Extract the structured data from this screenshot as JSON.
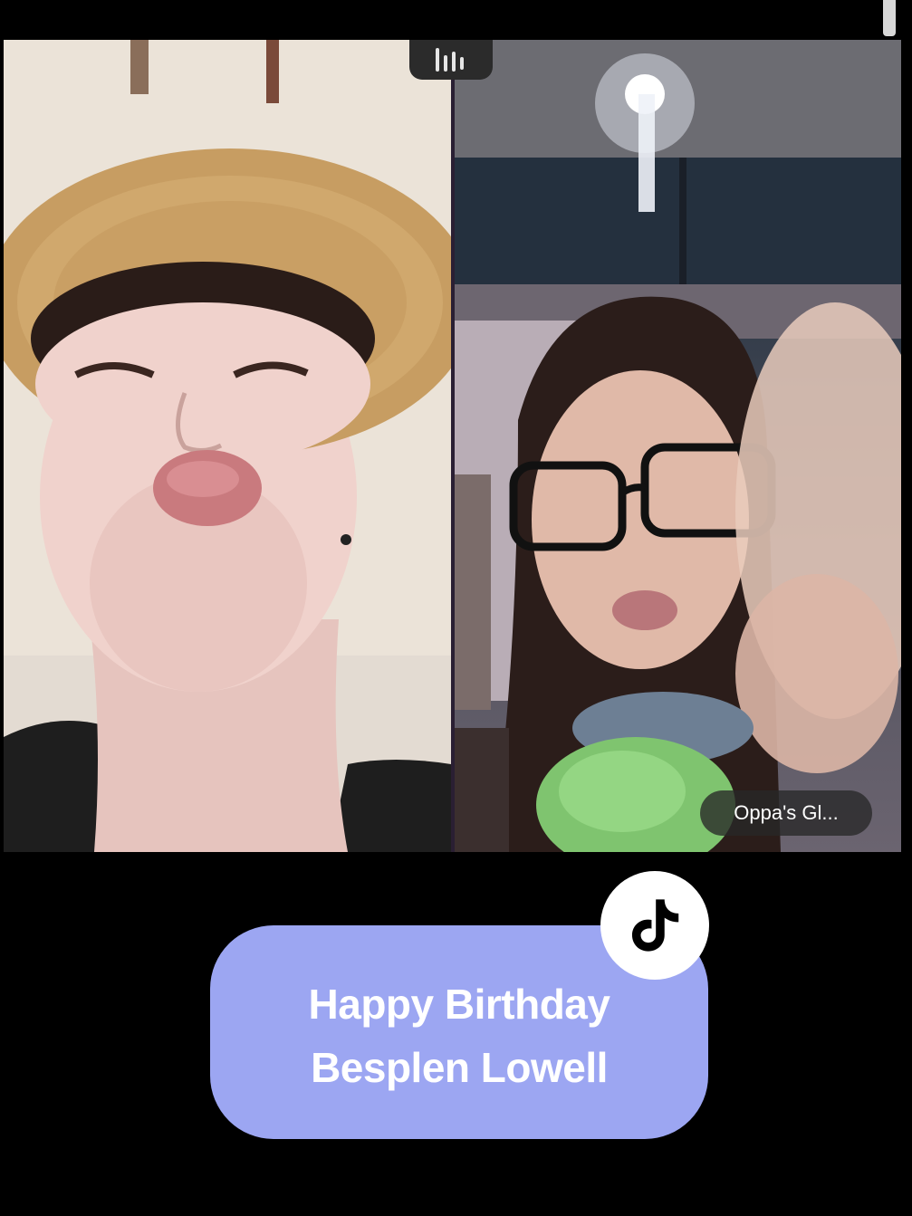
{
  "call": {
    "speaker_indicator_icon": "speaker-bars-icon",
    "left_participant_icon": "person-in-straw-hat",
    "right_participant_icon": "person-with-glasses",
    "right_participant_name": "Oppa's Gl..."
  },
  "caption": {
    "line1": "Happy Birthday",
    "line2": "Besplen Lowell"
  },
  "badge": {
    "icon": "tiktok-logo-icon"
  },
  "colors": {
    "background": "#000000",
    "caption_bubble": "#9ca6f2",
    "caption_text": "#ffffff",
    "name_tag_bg": "#282828",
    "badge_bg": "#ffffff"
  }
}
